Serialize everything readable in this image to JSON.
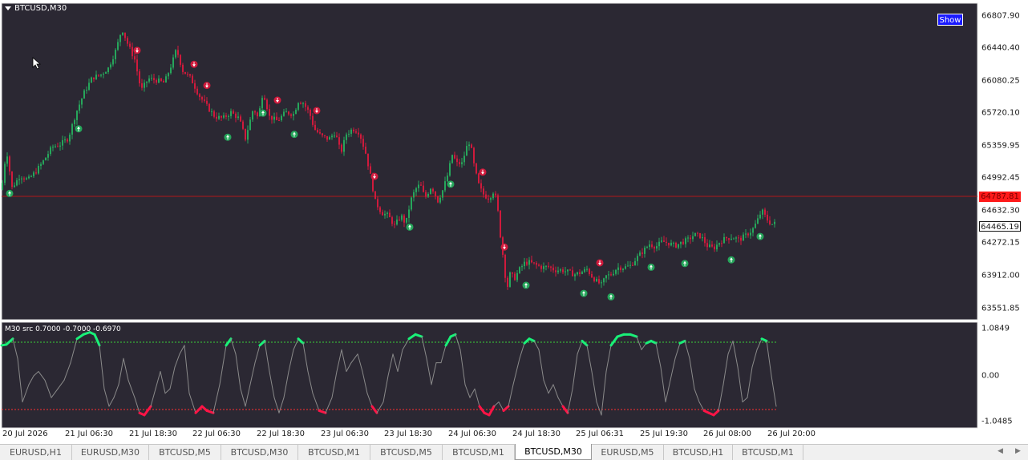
{
  "window": {
    "symbol_title": "BTCUSD,M30",
    "show_button": "Show"
  },
  "price_axis": {
    "labels": [
      "66807.90",
      "66440.40",
      "66080.25",
      "65720.10",
      "65359.95",
      "64992.45",
      "64632.30",
      "64272.15",
      "63912.00",
      "63551.85"
    ],
    "alert_price": "64787.81",
    "last_price": "64465.19"
  },
  "indicator": {
    "caption": "M30 src  0.7000 -0.7000 -0.6970",
    "axis_labels": [
      "1.0849",
      "0.00",
      "-1.0485"
    ],
    "upper_level": 0.7,
    "lower_level": -0.7,
    "colors": {
      "line": "#8a8a8a",
      "bull": "#19f078",
      "bear": "#ff1446",
      "upper_level": "#3ad23a",
      "lower_level": "#ff3030"
    }
  },
  "time_axis": {
    "labels": [
      "20 Jul 2026",
      "21 Jul 06:30",
      "21 Jul 18:30",
      "22 Jul 06:30",
      "22 Jul 18:30",
      "23 Jul 06:30",
      "23 Jul 18:30",
      "24 Jul 06:30",
      "24 Jul 18:30",
      "25 Jul 06:31",
      "25 Jul 19:30",
      "26 Jul 08:00",
      "26 Jul 20:00"
    ]
  },
  "colors": {
    "background": "#2b2833",
    "bull_candle": "#26a65b",
    "bear_candle": "#d01a3c",
    "alert_line": "#b01818",
    "frame": "#e0e0e0"
  },
  "icons": {
    "cursor": "arrow-cursor-icon",
    "buy_marker": "up-arrow-circle-icon",
    "sell_marker": "down-arrow-circle-icon"
  },
  "tabs": [
    "EURUSD,H1",
    "EURUSD,M30",
    "BTCUSD,M5",
    "BTCUSD,M30",
    "BTCUSD,M1",
    "BTCUSD,M5",
    "BTCUSD,M1",
    "BTCUSD,M30",
    "EURUSD,M5",
    "BTCUSD,H1",
    "BTCUSD,M1"
  ],
  "active_tab": 7,
  "chart_data": {
    "type": "candlestick",
    "symbol": "BTCUSD",
    "timeframe": "M30",
    "ylim": [
      63440,
      66880
    ],
    "close_path": [
      [
        0,
        64700
      ],
      [
        8,
        65330
      ],
      [
        15,
        64880
      ],
      [
        25,
        65020
      ],
      [
        35,
        64970
      ],
      [
        45,
        65070
      ],
      [
        55,
        65200
      ],
      [
        65,
        65350
      ],
      [
        75,
        65380
      ],
      [
        85,
        65450
      ],
      [
        95,
        65750
      ],
      [
        105,
        65980
      ],
      [
        115,
        66150
      ],
      [
        125,
        66180
      ],
      [
        135,
        66260
      ],
      [
        145,
        66480
      ],
      [
        152,
        66720
      ],
      [
        160,
        66520
      ],
      [
        168,
        66360
      ],
      [
        176,
        66000
      ],
      [
        185,
        66140
      ],
      [
        195,
        66120
      ],
      [
        205,
        66090
      ],
      [
        215,
        66330
      ],
      [
        220,
        66480
      ],
      [
        228,
        66230
      ],
      [
        238,
        66140
      ],
      [
        248,
        65950
      ],
      [
        258,
        65820
      ],
      [
        268,
        65700
      ],
      [
        278,
        65680
      ],
      [
        288,
        65750
      ],
      [
        298,
        65680
      ],
      [
        306,
        65450
      ],
      [
        316,
        65800
      ],
      [
        322,
        65680
      ],
      [
        328,
        66000
      ],
      [
        336,
        65700
      ],
      [
        346,
        65650
      ],
      [
        356,
        65750
      ],
      [
        366,
        65730
      ],
      [
        372,
        65880
      ],
      [
        378,
        65860
      ],
      [
        386,
        65740
      ],
      [
        392,
        65560
      ],
      [
        400,
        65480
      ],
      [
        410,
        65440
      ],
      [
        418,
        65520
      ],
      [
        425,
        65280
      ],
      [
        432,
        65500
      ],
      [
        440,
        65560
      ],
      [
        448,
        65520
      ],
      [
        456,
        65280
      ],
      [
        462,
        65020
      ],
      [
        468,
        64720
      ],
      [
        476,
        64590
      ],
      [
        484,
        64560
      ],
      [
        492,
        64440
      ],
      [
        500,
        64560
      ],
      [
        506,
        64460
      ],
      [
        512,
        64730
      ],
      [
        518,
        64860
      ],
      [
        524,
        64920
      ],
      [
        530,
        64760
      ],
      [
        538,
        64900
      ],
      [
        546,
        64730
      ],
      [
        552,
        64850
      ],
      [
        558,
        65020
      ],
      [
        564,
        65260
      ],
      [
        570,
        65160
      ],
      [
        576,
        65160
      ],
      [
        582,
        65350
      ],
      [
        586,
        65420
      ],
      [
        592,
        65090
      ],
      [
        598,
        64880
      ],
      [
        604,
        64790
      ],
      [
        610,
        64760
      ],
      [
        616,
        64850
      ],
      [
        620,
        64690
      ],
      [
        624,
        64330
      ],
      [
        628,
        64040
      ],
      [
        632,
        63700
      ],
      [
        636,
        63880
      ],
      [
        642,
        63840
      ],
      [
        648,
        63940
      ],
      [
        654,
        64010
      ],
      [
        660,
        64020
      ],
      [
        668,
        63990
      ],
      [
        676,
        63960
      ],
      [
        684,
        63970
      ],
      [
        692,
        63930
      ],
      [
        700,
        63930
      ],
      [
        708,
        63910
      ],
      [
        716,
        63880
      ],
      [
        724,
        63900
      ],
      [
        732,
        63940
      ],
      [
        738,
        63860
      ],
      [
        744,
        63800
      ],
      [
        750,
        63760
      ],
      [
        756,
        63860
      ],
      [
        762,
        63880
      ],
      [
        770,
        63960
      ],
      [
        778,
        63960
      ],
      [
        786,
        63980
      ],
      [
        794,
        64070
      ],
      [
        802,
        64150
      ],
      [
        810,
        64230
      ],
      [
        818,
        64200
      ],
      [
        826,
        64260
      ],
      [
        834,
        64240
      ],
      [
        842,
        64210
      ],
      [
        850,
        64250
      ],
      [
        858,
        64280
      ],
      [
        866,
        64340
      ],
      [
        874,
        64320
      ],
      [
        882,
        64210
      ],
      [
        890,
        64180
      ],
      [
        898,
        64260
      ],
      [
        906,
        64300
      ],
      [
        914,
        64310
      ],
      [
        922,
        64280
      ],
      [
        930,
        64330
      ],
      [
        938,
        64390
      ],
      [
        944,
        64490
      ],
      [
        950,
        64620
      ],
      [
        956,
        64520
      ],
      [
        962,
        64460
      ],
      [
        968,
        64470
      ]
    ],
    "alert_price": 64787.81,
    "last_price": 64465.19,
    "markers": [
      {
        "type": "buy",
        "x": 12
      },
      {
        "type": "buy",
        "x": 98
      },
      {
        "type": "sell",
        "x": 171
      },
      {
        "type": "sell",
        "x": 242
      },
      {
        "type": "sell",
        "x": 258
      },
      {
        "type": "buy",
        "x": 284
      },
      {
        "type": "buy",
        "x": 328
      },
      {
        "type": "sell",
        "x": 346
      },
      {
        "type": "buy",
        "x": 367
      },
      {
        "type": "sell",
        "x": 395
      },
      {
        "type": "sell",
        "x": 467
      },
      {
        "type": "buy",
        "x": 511
      },
      {
        "type": "buy",
        "x": 562
      },
      {
        "type": "sell",
        "x": 602
      },
      {
        "type": "sell",
        "x": 629
      },
      {
        "type": "buy",
        "x": 656
      },
      {
        "type": "buy",
        "x": 728
      },
      {
        "type": "sell",
        "x": 748
      },
      {
        "type": "buy",
        "x": 762
      },
      {
        "type": "buy",
        "x": 812
      },
      {
        "type": "buy",
        "x": 854
      },
      {
        "type": "buy",
        "x": 912
      },
      {
        "type": "buy",
        "x": 948
      }
    ]
  },
  "indicator_data": {
    "ylim": [
      -1.0485,
      1.0849
    ],
    "peaks": [
      [
        2,
        0.7
      ],
      [
        8,
        0.72
      ],
      [
        16,
        0.85
      ],
      [
        22,
        0.4
      ],
      [
        28,
        -0.6
      ],
      [
        36,
        -0.2
      ],
      [
        42,
        0.0
      ],
      [
        48,
        0.1
      ],
      [
        56,
        -0.1
      ],
      [
        64,
        -0.5
      ],
      [
        72,
        -0.3
      ],
      [
        80,
        -0.1
      ],
      [
        88,
        0.3
      ],
      [
        96,
        0.85
      ],
      [
        104,
        0.95
      ],
      [
        112,
        1.0
      ],
      [
        118,
        0.95
      ],
      [
        124,
        0.7
      ],
      [
        130,
        -0.3
      ],
      [
        136,
        -0.7
      ],
      [
        142,
        -0.5
      ],
      [
        148,
        -0.2
      ],
      [
        154,
        0.4
      ],
      [
        160,
        -0.1
      ],
      [
        168,
        -0.5
      ],
      [
        174,
        -0.85
      ],
      [
        180,
        -0.9
      ],
      [
        188,
        -0.7
      ],
      [
        194,
        -0.3
      ],
      [
        200,
        0.1
      ],
      [
        206,
        -0.4
      ],
      [
        212,
        -0.3
      ],
      [
        218,
        0.2
      ],
      [
        224,
        0.5
      ],
      [
        230,
        0.7
      ],
      [
        236,
        -0.4
      ],
      [
        244,
        -0.85
      ],
      [
        252,
        -0.7
      ],
      [
        258,
        -0.8
      ],
      [
        266,
        -0.85
      ],
      [
        274,
        -0.2
      ],
      [
        282,
        0.7
      ],
      [
        288,
        0.85
      ],
      [
        294,
        0.5
      ],
      [
        300,
        -0.3
      ],
      [
        306,
        -0.7
      ],
      [
        312,
        -0.2
      ],
      [
        318,
        0.3
      ],
      [
        324,
        0.7
      ],
      [
        330,
        0.8
      ],
      [
        336,
        0.1
      ],
      [
        342,
        -0.5
      ],
      [
        348,
        -0.85
      ],
      [
        354,
        -0.5
      ],
      [
        360,
        0.1
      ],
      [
        366,
        0.6
      ],
      [
        372,
        0.85
      ],
      [
        378,
        0.75
      ],
      [
        384,
        0.1
      ],
      [
        390,
        -0.4
      ],
      [
        398,
        -0.8
      ],
      [
        406,
        -0.85
      ],
      [
        414,
        -0.5
      ],
      [
        420,
        0.1
      ],
      [
        426,
        0.6
      ],
      [
        432,
        0.1
      ],
      [
        438,
        0.3
      ],
      [
        446,
        0.5
      ],
      [
        452,
        0.1
      ],
      [
        458,
        -0.4
      ],
      [
        464,
        -0.7
      ],
      [
        470,
        -0.85
      ],
      [
        478,
        -0.6
      ],
      [
        484,
        0.0
      ],
      [
        490,
        0.5
      ],
      [
        496,
        0.1
      ],
      [
        502,
        0.6
      ],
      [
        510,
        0.85
      ],
      [
        518,
        0.95
      ],
      [
        526,
        0.9
      ],
      [
        532,
        0.4
      ],
      [
        538,
        -0.2
      ],
      [
        544,
        0.3
      ],
      [
        550,
        0.3
      ],
      [
        556,
        0.7
      ],
      [
        562,
        0.9
      ],
      [
        568,
        0.95
      ],
      [
        574,
        0.6
      ],
      [
        580,
        -0.2
      ],
      [
        586,
        -0.5
      ],
      [
        592,
        -0.3
      ],
      [
        598,
        -0.7
      ],
      [
        604,
        -0.85
      ],
      [
        610,
        -0.9
      ],
      [
        616,
        -0.7
      ],
      [
        622,
        -0.6
      ],
      [
        628,
        -0.8
      ],
      [
        634,
        -0.7
      ],
      [
        640,
        -0.2
      ],
      [
        648,
        0.4
      ],
      [
        654,
        0.75
      ],
      [
        660,
        0.85
      ],
      [
        666,
        0.8
      ],
      [
        672,
        0.6
      ],
      [
        678,
        -0.1
      ],
      [
        684,
        -0.4
      ],
      [
        690,
        -0.2
      ],
      [
        696,
        -0.5
      ],
      [
        702,
        -0.7
      ],
      [
        708,
        -0.85
      ],
      [
        714,
        -0.3
      ],
      [
        720,
        0.5
      ],
      [
        726,
        0.8
      ],
      [
        732,
        0.7
      ],
      [
        738,
        0.1
      ],
      [
        744,
        -0.6
      ],
      [
        750,
        -0.9
      ],
      [
        756,
        0.1
      ],
      [
        762,
        0.7
      ],
      [
        770,
        0.9
      ],
      [
        778,
        0.95
      ],
      [
        786,
        0.95
      ],
      [
        794,
        0.9
      ],
      [
        800,
        0.6
      ],
      [
        806,
        0.75
      ],
      [
        812,
        0.8
      ],
      [
        818,
        0.75
      ],
      [
        824,
        0.2
      ],
      [
        830,
        -0.6
      ],
      [
        836,
        -0.1
      ],
      [
        842,
        0.4
      ],
      [
        848,
        0.75
      ],
      [
        854,
        0.8
      ],
      [
        860,
        0.4
      ],
      [
        866,
        -0.3
      ],
      [
        872,
        -0.6
      ],
      [
        878,
        -0.8
      ],
      [
        884,
        -0.85
      ],
      [
        890,
        -0.9
      ],
      [
        896,
        -0.8
      ],
      [
        902,
        -0.2
      ],
      [
        908,
        0.5
      ],
      [
        914,
        0.8
      ],
      [
        920,
        0.2
      ],
      [
        926,
        -0.6
      ],
      [
        932,
        -0.5
      ],
      [
        938,
        0.2
      ],
      [
        944,
        0.6
      ],
      [
        950,
        0.85
      ],
      [
        956,
        0.8
      ],
      [
        962,
        0.0
      ],
      [
        968,
        -0.7
      ]
    ]
  }
}
